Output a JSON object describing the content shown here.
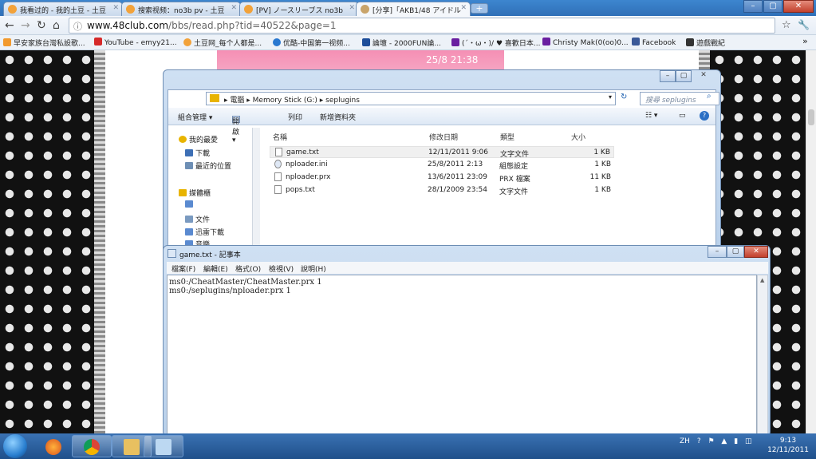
{
  "browser": {
    "tabs": [
      {
        "label": "我看过的 - 我的土豆 - 土豆"
      },
      {
        "label": "搜索视频：no3b pv - 土豆"
      },
      {
        "label": "[PV] ノースリーブス no3b"
      },
      {
        "label": "[分享]「AKB1/48 アイドル"
      }
    ],
    "new_tab": "+",
    "window_buttons": {
      "minimize": "–",
      "maximize": "▢",
      "close": "✕"
    },
    "url_host": "www.48club.com",
    "url_path": "/bbs/read.php?tid=40522&page=1",
    "star": "☆",
    "wrench": "🔧",
    "bookmarks": [
      "早安家族台灣私設歌...",
      "YouTube - emyy21...",
      "土豆网_每个人都是...",
      "优酷-中国第一视频...",
      "論壇 - 2000FUN論...",
      "(´・ω・)/ ♥ 喜歡日本...",
      "Christy Mak(0(oo)0...",
      "Facebook",
      "遊戲戰紀"
    ],
    "bookmarks_more": "»"
  },
  "page": {
    "clock": "25/8 21:38"
  },
  "explorer": {
    "breadcrumb": [
      "電腦",
      "Memory Stick (G:)",
      "seplugins"
    ],
    "search_placeholder": "搜尋 seplugins",
    "commands": [
      "組合管理 ▾",
      "開啟 ▾",
      "列印",
      "新增資料夾"
    ],
    "sidebar": [
      {
        "label": "我的最愛",
        "color": "#e8b400"
      },
      {
        "label": "下載",
        "color": "#3d6fb5"
      },
      {
        "label": "最近的位置",
        "color": "#6e8fb5"
      },
      {
        "label": "媒體櫃",
        "color": "#e8b400"
      },
      {
        "label": "",
        "color": "#5a8ad0"
      },
      {
        "label": "文件",
        "color": "#7a9ac0"
      },
      {
        "label": "迅雷下載",
        "color": "#5a8ad0"
      },
      {
        "label": "音樂",
        "color": "#5a8ad0"
      }
    ],
    "columns": [
      "名稱",
      "修改日期",
      "類型",
      "大小"
    ],
    "files": [
      {
        "name": "game.txt",
        "date": "12/11/2011 9:06",
        "type": "文字文件",
        "size": "1 KB"
      },
      {
        "name": "nploader.ini",
        "date": "25/8/2011 2:13",
        "type": "組態設定",
        "size": "1 KB"
      },
      {
        "name": "nploader.prx",
        "date": "13/6/2011 23:09",
        "type": "PRX 檔案",
        "size": "11 KB"
      },
      {
        "name": "pops.txt",
        "date": "28/1/2009 23:54",
        "type": "文字文件",
        "size": "1 KB"
      }
    ]
  },
  "notepad": {
    "title": "game.txt - 記事本",
    "menu": [
      "檔案(F)",
      "編輯(E)",
      "格式(O)",
      "檢視(V)",
      "說明(H)"
    ],
    "content": "ms0:/CheatMaster/CheatMaster.prx 1\nms0:/seplugins/nploader.prx 1",
    "buttons": {
      "minimize": "–",
      "maximize": "▢",
      "close": "✕"
    }
  },
  "taskbar": {
    "tray": "ZH",
    "time": "9:13",
    "date": "12/11/2011"
  }
}
